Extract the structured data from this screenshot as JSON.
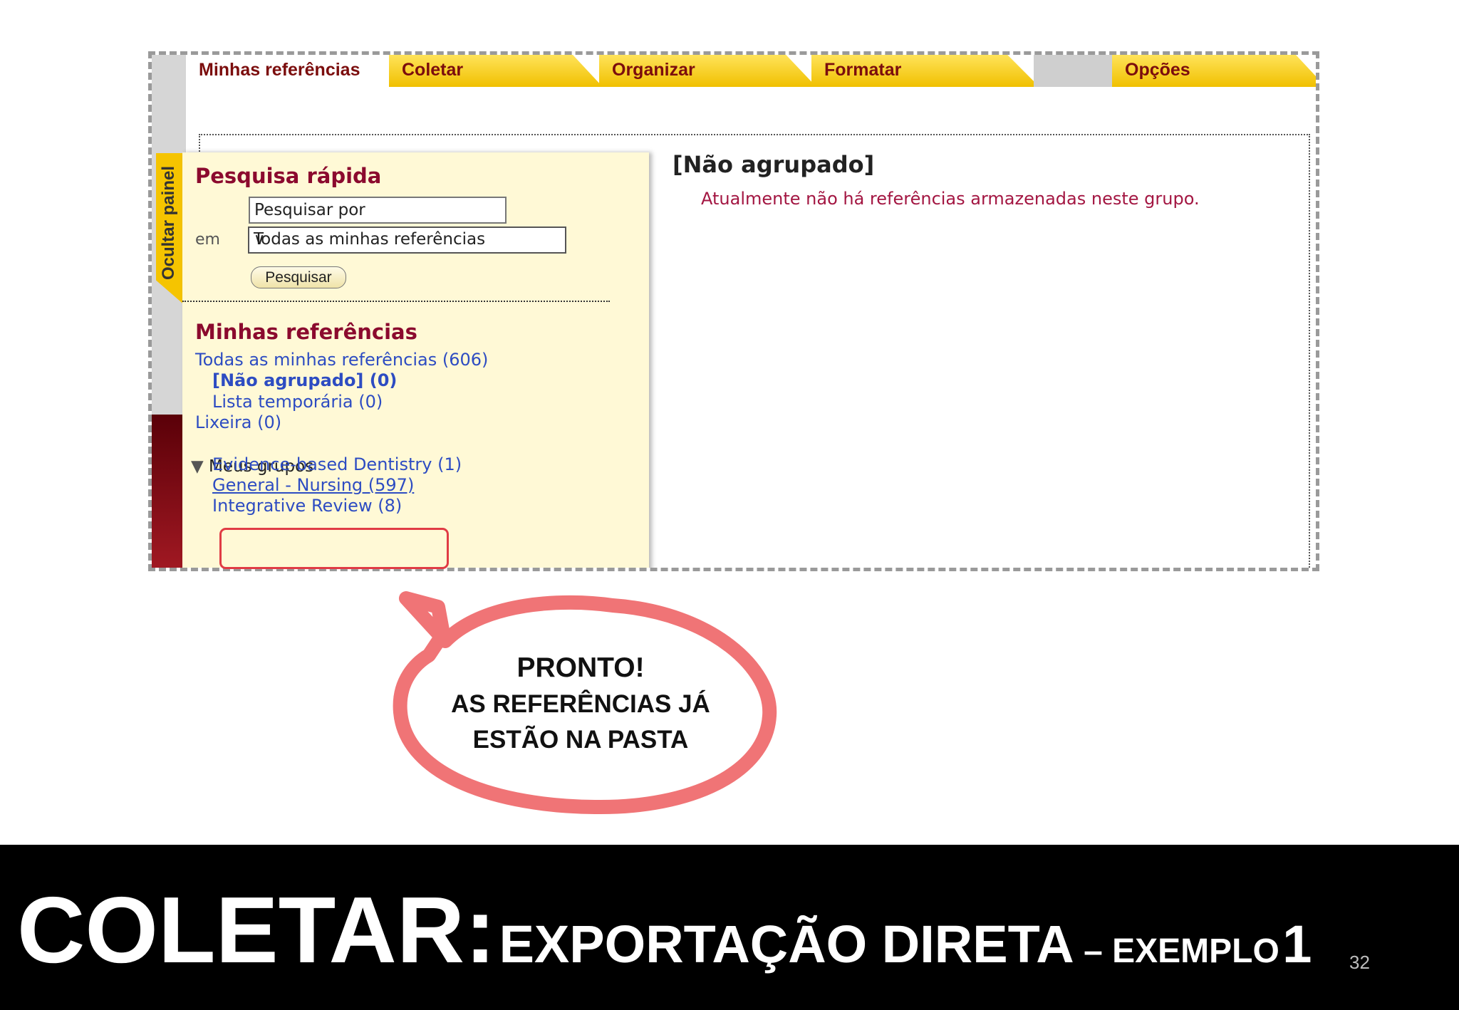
{
  "tabs": [
    {
      "label": "Minhas referências",
      "active": true
    },
    {
      "label": "Coletar",
      "active": false
    },
    {
      "label": "Organizar",
      "active": false
    },
    {
      "label": "Formatar",
      "active": false
    },
    {
      "label": "Opções",
      "active": false
    }
  ],
  "side_toggle": {
    "label": "Ocultar painel"
  },
  "quick_search": {
    "heading": "Pesquisa rápida",
    "input_value": "Pesquisar por",
    "scope_label": "em",
    "scope_selected": "Todas as minhas referências",
    "button_label": "Pesquisar"
  },
  "my_refs": {
    "heading": "Minhas referências",
    "all": "Todas as minhas referências (606)",
    "unfiled": "[Não agrupado] (0)",
    "quick_list": "Lista temporária (0)",
    "trash": "Lixeira (0)",
    "groups_label": "Meus grupos",
    "groups": [
      {
        "label": "Evidence-based Dentistry  (1)"
      },
      {
        "label": "General - Nursing  (597)"
      },
      {
        "label": "Integrative Review  (8)"
      }
    ]
  },
  "main": {
    "group_title": "[Não agrupado]",
    "empty_message": "Atualmente não há referências armazenadas neste grupo."
  },
  "callout": {
    "line1": "PRONTO!",
    "line2": "AS REFERÊNCIAS JÁ",
    "line3": "ESTÃO NA PASTA"
  },
  "slide_title": {
    "main": "COLETAR:",
    "sub": "EXPORTAÇÃO DIRETA",
    "dash": " – ",
    "small": "EXEMPLO",
    "num": "1"
  },
  "page_number": "32",
  "colors": {
    "tab_yellow": "#f0c000",
    "heading_red": "#8b0a2e",
    "link_blue": "#2d4cc2",
    "callout_border": "#f07476",
    "highlight_red": "#e03c45"
  }
}
